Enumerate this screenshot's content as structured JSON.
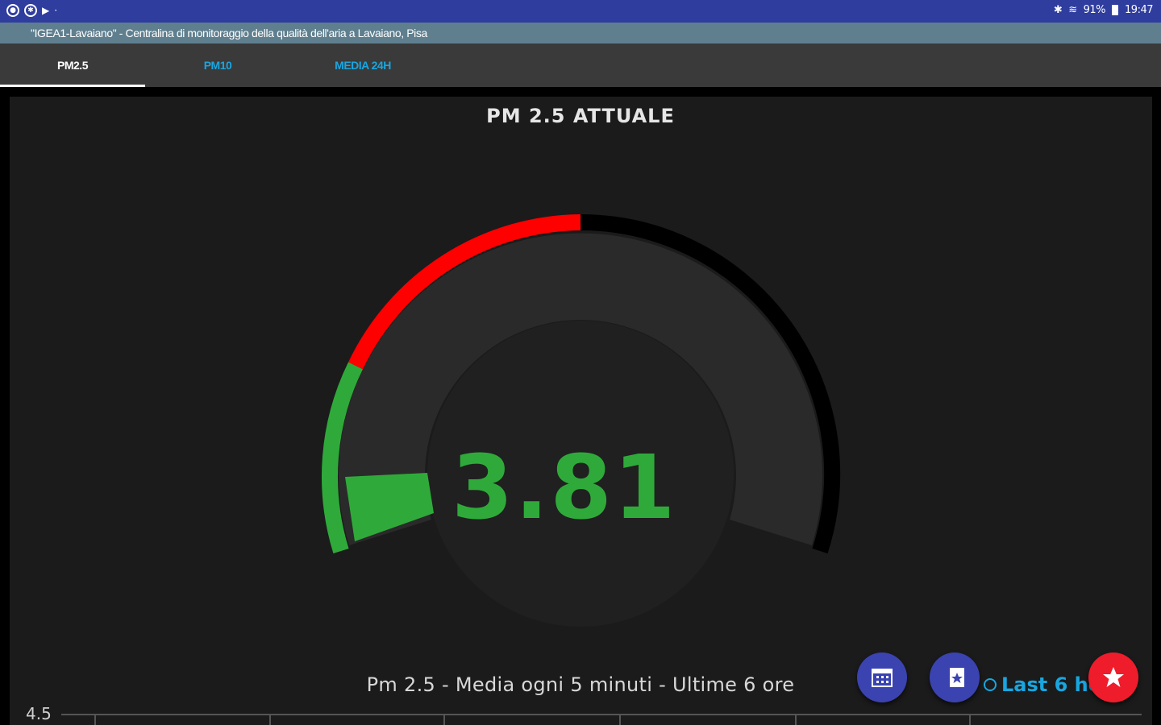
{
  "status_bar": {
    "battery": "91%",
    "time": "19:47"
  },
  "app_bar": {
    "title": "\"IGEA1-Lavaiano\" - Centralina di monitoraggio della qualità dell'aria a Lavaiano, Pisa"
  },
  "tabs": [
    {
      "label": "PM2.5",
      "active": true
    },
    {
      "label": "PM10",
      "active": false
    },
    {
      "label": "MEDIA 24H",
      "active": false
    }
  ],
  "gauge": {
    "title": "PM 2.5 ATTUALE",
    "value": "3.81",
    "colors": {
      "good": "#2faa3a",
      "bad": "#ff0000",
      "track": "#000000",
      "face": "#2a2a2a"
    }
  },
  "chart": {
    "title": "Pm 2.5 - Media ogni 5 minuti - Ultime 6 ore",
    "y_top_label": "4.5"
  },
  "toolbar": {
    "range_label": "Last 6 hours"
  },
  "icons": {
    "calendar": "calendar-grid-icon",
    "bookmark": "bookmark-star-icon",
    "favorite": "star-icon",
    "clock": "clock-icon"
  }
}
